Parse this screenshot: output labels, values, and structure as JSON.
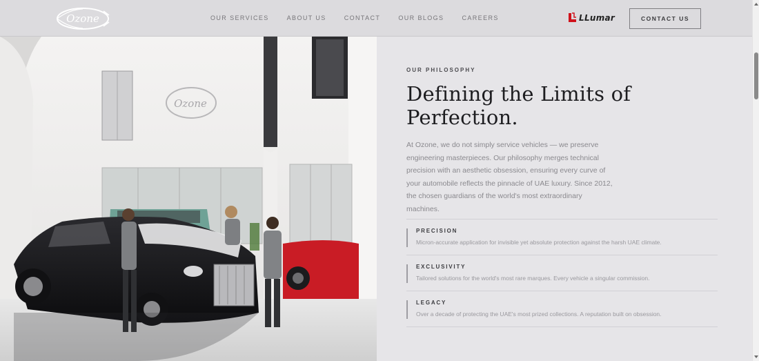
{
  "header": {
    "logo_text": "Ozone",
    "nav": [
      "OUR SERVICES",
      "ABOUT US",
      "CONTACT",
      "OUR BLOGS",
      "CAREERS"
    ],
    "partner_logo": "LLumar",
    "contact_button": "CONTACT US"
  },
  "hero": {
    "wall_logo_text": "Ozone"
  },
  "philosophy": {
    "eyebrow": "OUR PHILOSOPHY",
    "headline": "Defining the Limits of Perfection.",
    "intro": "At Ozone, we do not simply service vehicles — we preserve engineering masterpieces. Our philosophy merges technical precision with an aesthetic obsession, ensuring every curve of your automobile reflects the pinnacle of UAE luxury. Since 2012, the chosen guardians of the world's most extraordinary machines.",
    "pillars": [
      {
        "title": "PRECISION",
        "description": "Micron-accurate application for invisible yet absolute protection against the harsh UAE climate."
      },
      {
        "title": "EXCLUSIVITY",
        "description": "Tailored solutions for the world's most rare marques. Every vehicle a singular commission."
      },
      {
        "title": "LEGACY",
        "description": "Over a decade of protecting the UAE's most prized collections. A reputation built on obsession."
      }
    ]
  },
  "colors": {
    "background": "#e6e5e8",
    "header": "#dcdbde",
    "partner_red": "#d0121b"
  }
}
